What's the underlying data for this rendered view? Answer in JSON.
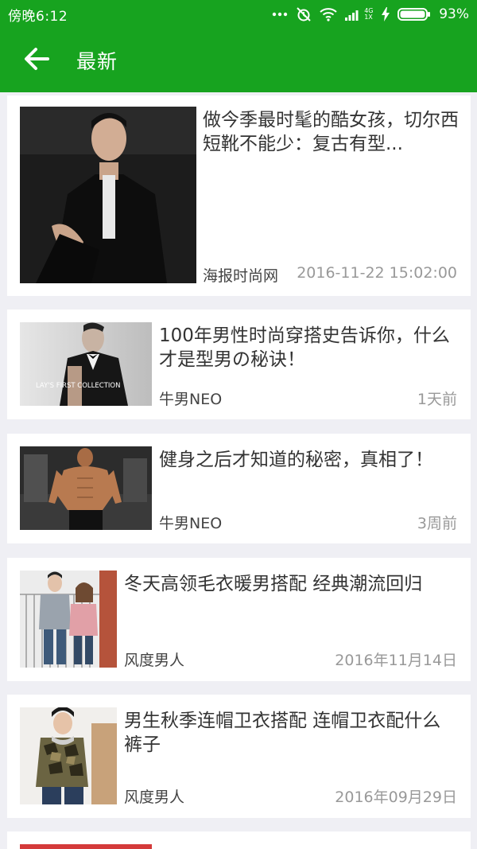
{
  "status_bar": {
    "time": "傍晚6:12",
    "network": "4G 1X",
    "battery": "93%",
    "battery_level": 0.93
  },
  "app_bar": {
    "back_icon": "arrow-left-icon",
    "title": "最新"
  },
  "colors": {
    "primary": "#17a31f",
    "background": "#efeff4",
    "card": "#ffffff",
    "title_text": "#333333",
    "meta_text": "#999999"
  },
  "articles": [
    {
      "title": "做今季最时髦的酷女孩，切尔西短靴不能少：复古有型...",
      "source": "海报时尚网",
      "time": "2016-11-22 15:02:00",
      "image": "man-in-black-jacket-photo"
    },
    {
      "title": "100年男性时尚穿搭史告诉你，什么才是型男の秘诀！",
      "source": "牛男NEO",
      "time": "1天前",
      "image": "man-in-tuxedo-photo",
      "image_text": "LAY'S FIRST COLLECTION"
    },
    {
      "title": "健身之后才知道的秘密，真相了！",
      "source": "牛男NEO",
      "time": "3周前",
      "image": "muscular-man-gym-photo"
    },
    {
      "title": "冬天高领毛衣暖男搭配 经典潮流回归",
      "source": "风度男人",
      "time": "2016年11月14日",
      "image": "couple-sweaters-photo"
    },
    {
      "title": "男生秋季连帽卫衣搭配 连帽卫衣配什么裤子",
      "source": "风度男人",
      "time": "2016年09月29日",
      "image": "man-camo-hoodie-photo"
    }
  ]
}
